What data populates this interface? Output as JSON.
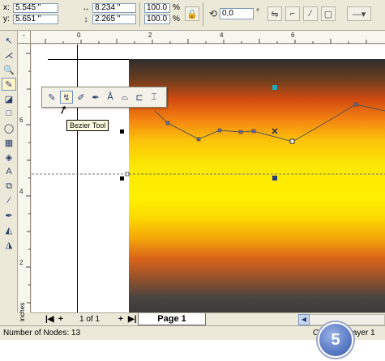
{
  "propbar": {
    "x_label": "x:",
    "x_value": "5.545 \"",
    "y_label": "y:",
    "y_value": "5.651 \"",
    "width_value": "8.234 \"",
    "height_value": "2.265 \"",
    "scale_x": "100.0",
    "scale_y": "100.0",
    "pct_sign": "%",
    "rotation_value": "0,0",
    "degree_sign": "°"
  },
  "ruler": {
    "h_numbers": [
      "0",
      "2",
      "4",
      "6"
    ],
    "v_numbers": [
      "6",
      "4",
      "2"
    ],
    "units": "inches"
  },
  "flyout": {
    "tooltip": "Bezier Tool"
  },
  "pagebar": {
    "page_count": "1 of 1",
    "page_tab": "Page 1"
  },
  "status": {
    "left": "Number of Nodes: 13",
    "right": "Curve on Layer 1"
  },
  "badge": {
    "step": "5"
  },
  "colors": {
    "node_cyan": "#20a8b8",
    "node_navy": "#2a3f78"
  }
}
